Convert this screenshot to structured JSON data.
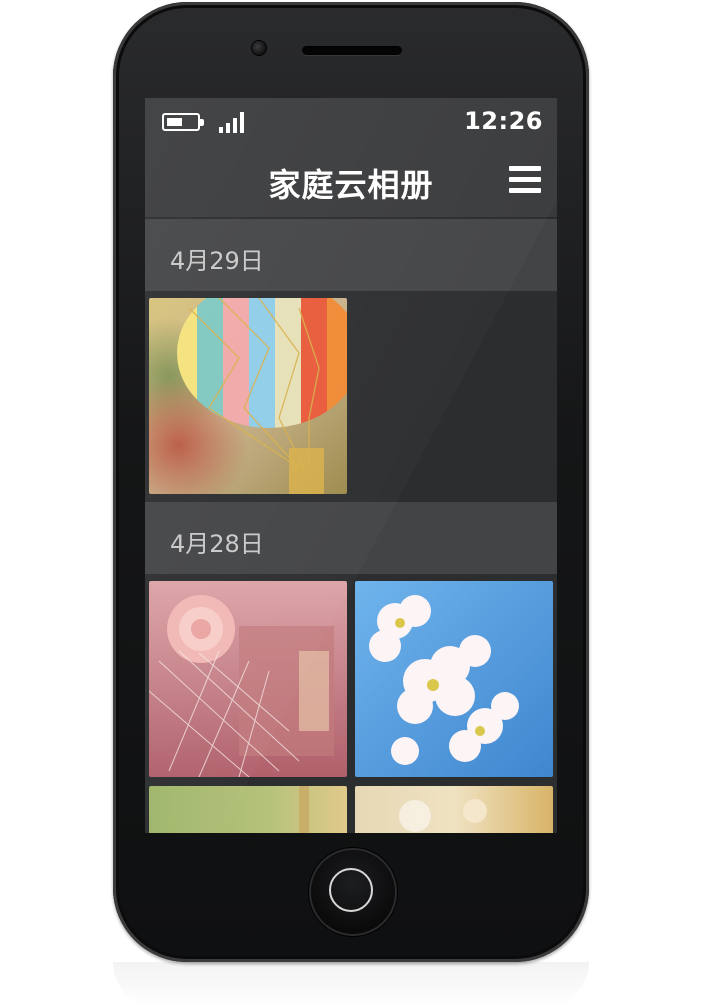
{
  "status_bar": {
    "time": "12:26",
    "battery_icon": "battery-icon",
    "signal_icon": "signal-icon"
  },
  "header": {
    "title": "家庭云相册",
    "menu_icon": "menu-icon"
  },
  "album": {
    "groups": [
      {
        "date": "4月29日",
        "photos": [
          "hot-air-balloon"
        ]
      },
      {
        "date": "4月28日",
        "photos": [
          "pink-flower-gift",
          "white-cherry-blossom",
          "green-field",
          "blurred-flowers"
        ]
      }
    ]
  },
  "colors": {
    "screen_bg": "#2c2d2f",
    "bar_bg": "#393a3c",
    "date_header_bg": "#434446",
    "phone_body": "#151617"
  }
}
